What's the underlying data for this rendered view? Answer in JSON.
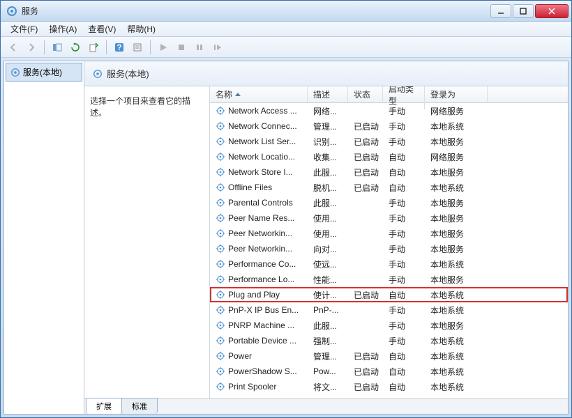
{
  "window": {
    "title": "服务"
  },
  "menu": {
    "file": "文件(F)",
    "action": "操作(A)",
    "view": "查看(V)",
    "help": "帮助(H)"
  },
  "left": {
    "item": "服务(本地)"
  },
  "header": {
    "text": "服务(本地)"
  },
  "desc": {
    "hint": "选择一个项目来查看它的描述。"
  },
  "columns": {
    "name": "名称",
    "desc": "描述",
    "status": "状态",
    "startup": "启动类型",
    "logon": "登录为"
  },
  "tabs": {
    "extended": "扩展",
    "standard": "标准"
  },
  "services": [
    {
      "name": "Network Access ...",
      "desc": "网络...",
      "status": "",
      "startup": "手动",
      "logon": "网络服务",
      "highlight": false
    },
    {
      "name": "Network Connec...",
      "desc": "管理...",
      "status": "已启动",
      "startup": "手动",
      "logon": "本地系统",
      "highlight": false
    },
    {
      "name": "Network List Ser...",
      "desc": "识别...",
      "status": "已启动",
      "startup": "手动",
      "logon": "本地服务",
      "highlight": false
    },
    {
      "name": "Network Locatio...",
      "desc": "收集...",
      "status": "已启动",
      "startup": "自动",
      "logon": "网络服务",
      "highlight": false
    },
    {
      "name": "Network Store I...",
      "desc": "此服...",
      "status": "已启动",
      "startup": "自动",
      "logon": "本地服务",
      "highlight": false
    },
    {
      "name": "Offline Files",
      "desc": "脱机...",
      "status": "已启动",
      "startup": "自动",
      "logon": "本地系统",
      "highlight": false
    },
    {
      "name": "Parental Controls",
      "desc": "此服...",
      "status": "",
      "startup": "手动",
      "logon": "本地服务",
      "highlight": false
    },
    {
      "name": "Peer Name Res...",
      "desc": "使用...",
      "status": "",
      "startup": "手动",
      "logon": "本地服务",
      "highlight": false
    },
    {
      "name": "Peer Networkin...",
      "desc": "使用...",
      "status": "",
      "startup": "手动",
      "logon": "本地服务",
      "highlight": false
    },
    {
      "name": "Peer Networkin...",
      "desc": "向对...",
      "status": "",
      "startup": "手动",
      "logon": "本地服务",
      "highlight": false
    },
    {
      "name": "Performance Co...",
      "desc": "使远...",
      "status": "",
      "startup": "手动",
      "logon": "本地系统",
      "highlight": false
    },
    {
      "name": "Performance Lo...",
      "desc": "性能...",
      "status": "",
      "startup": "手动",
      "logon": "本地服务",
      "highlight": false
    },
    {
      "name": "Plug and Play",
      "desc": "使计...",
      "status": "已启动",
      "startup": "自动",
      "logon": "本地系统",
      "highlight": true
    },
    {
      "name": "PnP-X IP Bus En...",
      "desc": "PnP-...",
      "status": "",
      "startup": "手动",
      "logon": "本地系统",
      "highlight": false
    },
    {
      "name": "PNRP Machine ...",
      "desc": "此服...",
      "status": "",
      "startup": "手动",
      "logon": "本地服务",
      "highlight": false
    },
    {
      "name": "Portable Device ...",
      "desc": "强制...",
      "status": "",
      "startup": "手动",
      "logon": "本地系统",
      "highlight": false
    },
    {
      "name": "Power",
      "desc": "管理...",
      "status": "已启动",
      "startup": "自动",
      "logon": "本地系统",
      "highlight": false
    },
    {
      "name": "PowerShadow S...",
      "desc": "Pow...",
      "status": "已启动",
      "startup": "自动",
      "logon": "本地系统",
      "highlight": false
    },
    {
      "name": "Print Spooler",
      "desc": "将文...",
      "status": "已启动",
      "startup": "自动",
      "logon": "本地系统",
      "highlight": false
    }
  ]
}
